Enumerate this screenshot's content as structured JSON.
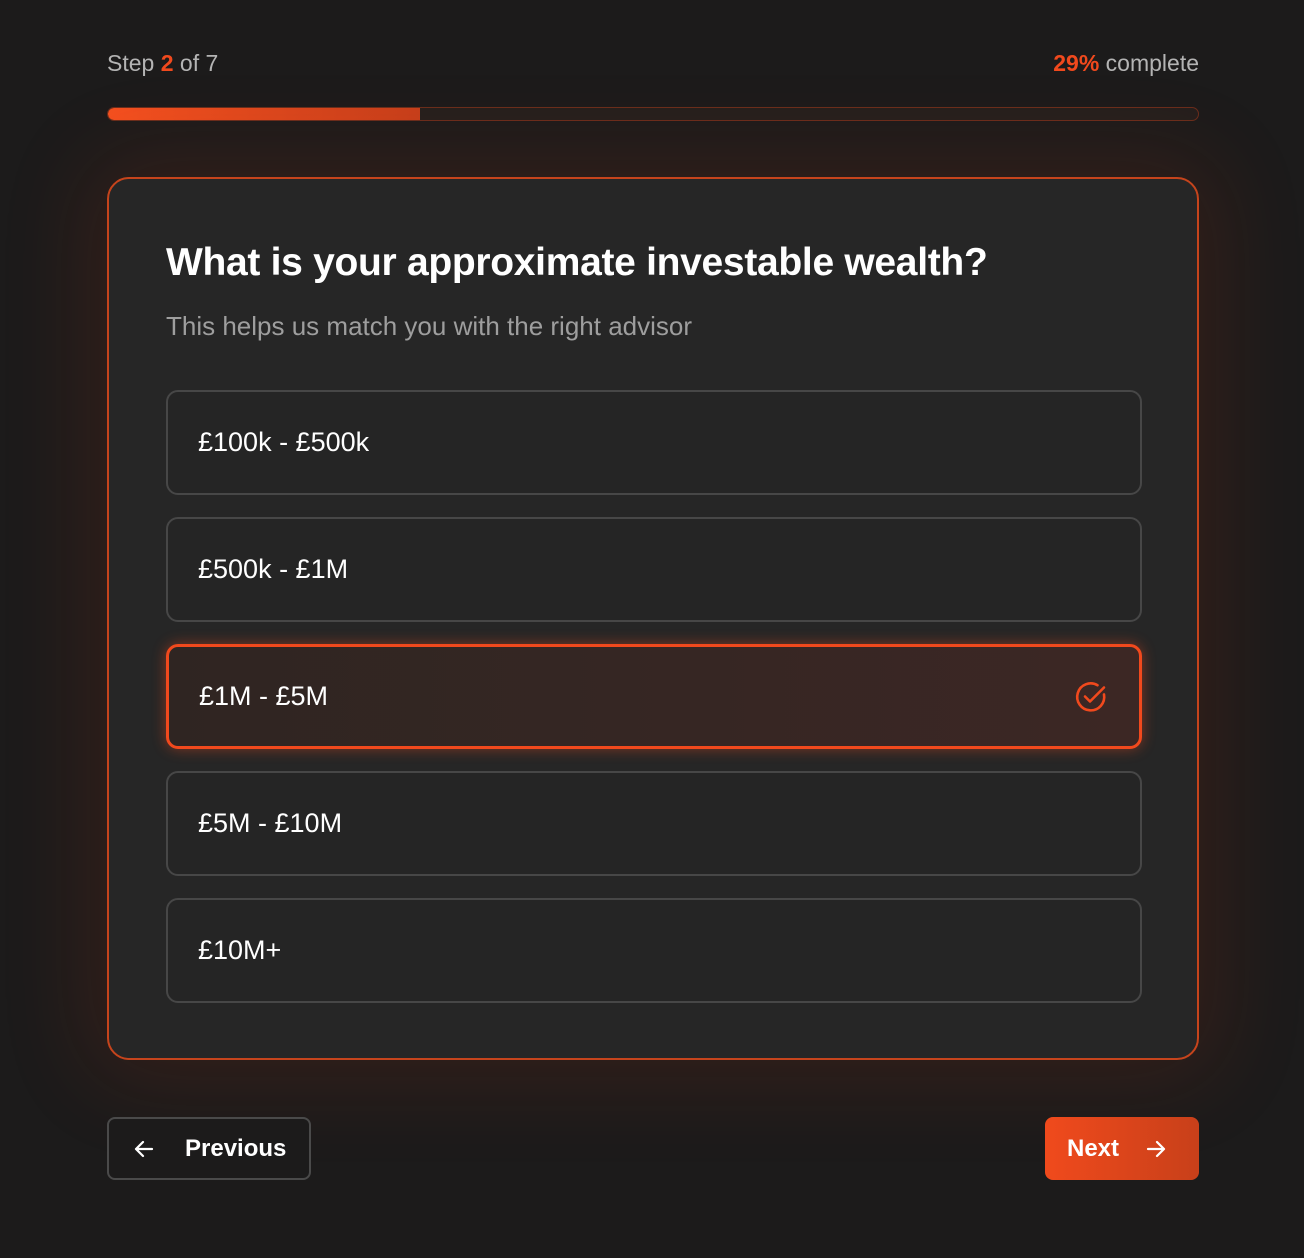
{
  "progress": {
    "step_prefix": "Step",
    "current_step": "2",
    "step_separator": "of",
    "total_steps": "7",
    "percent": "29%",
    "percent_suffix": "complete",
    "fraction": 0.286
  },
  "question": {
    "title": "What is your approximate investable wealth?",
    "subtitle": "This helps us match you with the right advisor"
  },
  "options": [
    {
      "label": "£100k - £500k",
      "selected": false
    },
    {
      "label": "£500k - £1M",
      "selected": false
    },
    {
      "label": "£1M - £5M",
      "selected": true
    },
    {
      "label": "£5M - £10M",
      "selected": false
    },
    {
      "label": "£10M+",
      "selected": false
    }
  ],
  "nav": {
    "previous_label": "Previous",
    "previous_icon": "arrow-left-icon",
    "next_label": "Next",
    "next_icon": "arrow-right-icon"
  },
  "colors": {
    "accent": "#f1491d",
    "background": "#1c1b1b",
    "card": "#262626"
  }
}
